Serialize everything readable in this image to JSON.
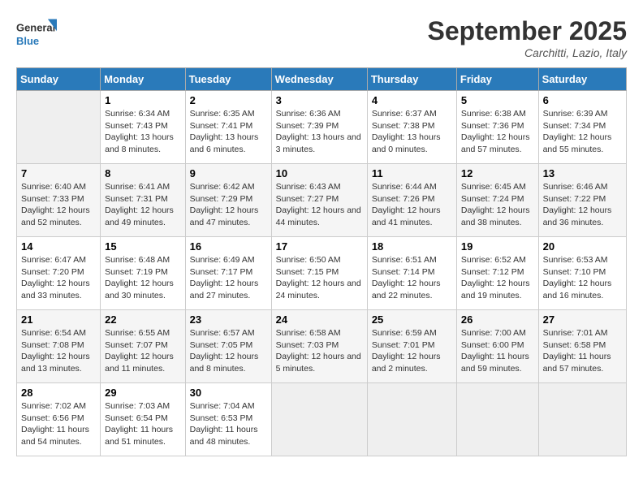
{
  "logo": {
    "line1": "General",
    "line2": "Blue"
  },
  "title": "September 2025",
  "location": "Carchitti, Lazio, Italy",
  "days_of_week": [
    "Sunday",
    "Monday",
    "Tuesday",
    "Wednesday",
    "Thursday",
    "Friday",
    "Saturday"
  ],
  "weeks": [
    [
      {
        "day": "",
        "info": ""
      },
      {
        "day": "1",
        "sunrise": "6:34 AM",
        "sunset": "7:43 PM",
        "daylight": "13 hours and 8 minutes."
      },
      {
        "day": "2",
        "sunrise": "6:35 AM",
        "sunset": "7:41 PM",
        "daylight": "13 hours and 6 minutes."
      },
      {
        "day": "3",
        "sunrise": "6:36 AM",
        "sunset": "7:39 PM",
        "daylight": "13 hours and 3 minutes."
      },
      {
        "day": "4",
        "sunrise": "6:37 AM",
        "sunset": "7:38 PM",
        "daylight": "13 hours and 0 minutes."
      },
      {
        "day": "5",
        "sunrise": "6:38 AM",
        "sunset": "7:36 PM",
        "daylight": "12 hours and 57 minutes."
      },
      {
        "day": "6",
        "sunrise": "6:39 AM",
        "sunset": "7:34 PM",
        "daylight": "12 hours and 55 minutes."
      }
    ],
    [
      {
        "day": "7",
        "sunrise": "6:40 AM",
        "sunset": "7:33 PM",
        "daylight": "12 hours and 52 minutes."
      },
      {
        "day": "8",
        "sunrise": "6:41 AM",
        "sunset": "7:31 PM",
        "daylight": "12 hours and 49 minutes."
      },
      {
        "day": "9",
        "sunrise": "6:42 AM",
        "sunset": "7:29 PM",
        "daylight": "12 hours and 47 minutes."
      },
      {
        "day": "10",
        "sunrise": "6:43 AM",
        "sunset": "7:27 PM",
        "daylight": "12 hours and 44 minutes."
      },
      {
        "day": "11",
        "sunrise": "6:44 AM",
        "sunset": "7:26 PM",
        "daylight": "12 hours and 41 minutes."
      },
      {
        "day": "12",
        "sunrise": "6:45 AM",
        "sunset": "7:24 PM",
        "daylight": "12 hours and 38 minutes."
      },
      {
        "day": "13",
        "sunrise": "6:46 AM",
        "sunset": "7:22 PM",
        "daylight": "12 hours and 36 minutes."
      }
    ],
    [
      {
        "day": "14",
        "sunrise": "6:47 AM",
        "sunset": "7:20 PM",
        "daylight": "12 hours and 33 minutes."
      },
      {
        "day": "15",
        "sunrise": "6:48 AM",
        "sunset": "7:19 PM",
        "daylight": "12 hours and 30 minutes."
      },
      {
        "day": "16",
        "sunrise": "6:49 AM",
        "sunset": "7:17 PM",
        "daylight": "12 hours and 27 minutes."
      },
      {
        "day": "17",
        "sunrise": "6:50 AM",
        "sunset": "7:15 PM",
        "daylight": "12 hours and 24 minutes."
      },
      {
        "day": "18",
        "sunrise": "6:51 AM",
        "sunset": "7:14 PM",
        "daylight": "12 hours and 22 minutes."
      },
      {
        "day": "19",
        "sunrise": "6:52 AM",
        "sunset": "7:12 PM",
        "daylight": "12 hours and 19 minutes."
      },
      {
        "day": "20",
        "sunrise": "6:53 AM",
        "sunset": "7:10 PM",
        "daylight": "12 hours and 16 minutes."
      }
    ],
    [
      {
        "day": "21",
        "sunrise": "6:54 AM",
        "sunset": "7:08 PM",
        "daylight": "12 hours and 13 minutes."
      },
      {
        "day": "22",
        "sunrise": "6:55 AM",
        "sunset": "7:07 PM",
        "daylight": "12 hours and 11 minutes."
      },
      {
        "day": "23",
        "sunrise": "6:57 AM",
        "sunset": "7:05 PM",
        "daylight": "12 hours and 8 minutes."
      },
      {
        "day": "24",
        "sunrise": "6:58 AM",
        "sunset": "7:03 PM",
        "daylight": "12 hours and 5 minutes."
      },
      {
        "day": "25",
        "sunrise": "6:59 AM",
        "sunset": "7:01 PM",
        "daylight": "12 hours and 2 minutes."
      },
      {
        "day": "26",
        "sunrise": "7:00 AM",
        "sunset": "6:00 PM",
        "daylight": "11 hours and 59 minutes."
      },
      {
        "day": "27",
        "sunrise": "7:01 AM",
        "sunset": "6:58 PM",
        "daylight": "11 hours and 57 minutes."
      }
    ],
    [
      {
        "day": "28",
        "sunrise": "7:02 AM",
        "sunset": "6:56 PM",
        "daylight": "11 hours and 54 minutes."
      },
      {
        "day": "29",
        "sunrise": "7:03 AM",
        "sunset": "6:54 PM",
        "daylight": "11 hours and 51 minutes."
      },
      {
        "day": "30",
        "sunrise": "7:04 AM",
        "sunset": "6:53 PM",
        "daylight": "11 hours and 48 minutes."
      },
      {
        "day": "",
        "info": ""
      },
      {
        "day": "",
        "info": ""
      },
      {
        "day": "",
        "info": ""
      },
      {
        "day": "",
        "info": ""
      }
    ]
  ],
  "labels": {
    "sunrise": "Sunrise:",
    "sunset": "Sunset:",
    "daylight": "Daylight:"
  }
}
